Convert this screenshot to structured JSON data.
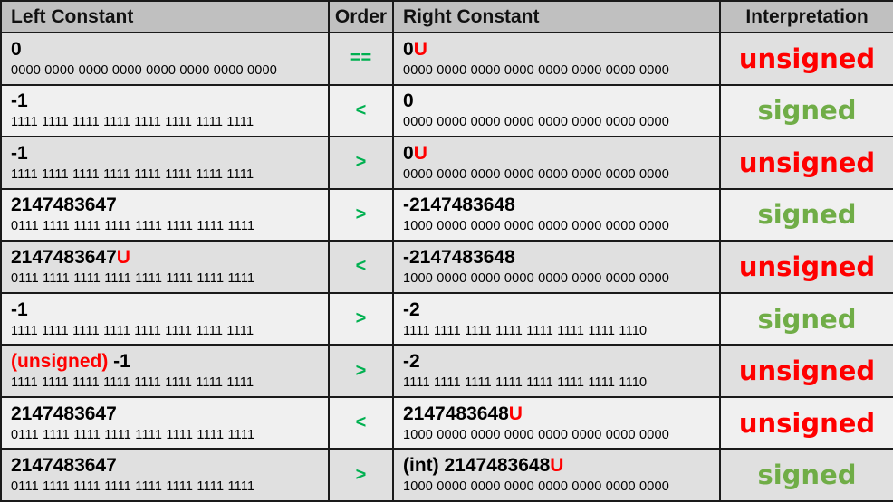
{
  "headers": {
    "left": "Left Constant",
    "order": "Order",
    "right": "Right Constant",
    "interp": "Interpretation"
  },
  "colors": {
    "unsigned": "#ff0000",
    "signed": "#70ad47",
    "order": "#00b050",
    "suffix": "#ff0000"
  },
  "rows": [
    {
      "left": {
        "prefix": "",
        "prefix_red": false,
        "value": "0",
        "suffix": ""
      },
      "left_bits": "0000 0000 0000 0000 0000 0000 0000 0000",
      "order": "==",
      "right": {
        "prefix": "",
        "prefix_red": false,
        "value": "0",
        "suffix": "U"
      },
      "right_bits": "0000 0000 0000 0000 0000 0000 0000 0000",
      "interp": "unsigned"
    },
    {
      "left": {
        "prefix": "",
        "prefix_red": false,
        "value": "-1",
        "suffix": ""
      },
      "left_bits": "1111 1111 1111 1111 1111 1111 1111 1111",
      "order": "<",
      "right": {
        "prefix": "",
        "prefix_red": false,
        "value": "0",
        "suffix": ""
      },
      "right_bits": "0000 0000 0000 0000 0000 0000 0000 0000",
      "interp": "signed"
    },
    {
      "left": {
        "prefix": "",
        "prefix_red": false,
        "value": "-1",
        "suffix": ""
      },
      "left_bits": "1111 1111 1111 1111 1111 1111 1111 1111",
      "order": ">",
      "right": {
        "prefix": "",
        "prefix_red": false,
        "value": "0",
        "suffix": "U"
      },
      "right_bits": "0000 0000 0000 0000 0000 0000 0000 0000",
      "interp": "unsigned"
    },
    {
      "left": {
        "prefix": "",
        "prefix_red": false,
        "value": "2147483647",
        "suffix": ""
      },
      "left_bits": "0111 1111 1111 1111 1111 1111 1111 1111",
      "order": ">",
      "right": {
        "prefix": "",
        "prefix_red": false,
        "value": "-2147483648",
        "suffix": ""
      },
      "right_bits": "1000 0000 0000 0000 0000 0000 0000 0000",
      "interp": "signed"
    },
    {
      "left": {
        "prefix": "",
        "prefix_red": false,
        "value": "2147483647",
        "suffix": "U"
      },
      "left_bits": "0111 1111 1111 1111 1111 1111 1111 1111",
      "order": "<",
      "right": {
        "prefix": "",
        "prefix_red": false,
        "value": "-2147483648",
        "suffix": ""
      },
      "right_bits": "1000 0000 0000 0000 0000 0000 0000 0000",
      "interp": "unsigned"
    },
    {
      "left": {
        "prefix": "",
        "prefix_red": false,
        "value": "-1",
        "suffix": ""
      },
      "left_bits": "1111 1111 1111 1111 1111 1111 1111 1111",
      "order": ">",
      "right": {
        "prefix": "",
        "prefix_red": false,
        "value": "-2",
        "suffix": ""
      },
      "right_bits": "1111 1111 1111 1111 1111 1111 1111 1110",
      "interp": "signed"
    },
    {
      "left": {
        "prefix": "(unsigned) ",
        "prefix_red": true,
        "value": "-1",
        "suffix": ""
      },
      "left_bits": "1111 1111 1111 1111 1111 1111 1111 1111",
      "order": ">",
      "right": {
        "prefix": "",
        "prefix_red": false,
        "value": "-2",
        "suffix": ""
      },
      "right_bits": "1111 1111 1111 1111 1111 1111 1111 1110",
      "interp": "unsigned"
    },
    {
      "left": {
        "prefix": "",
        "prefix_red": false,
        "value": "2147483647",
        "suffix": ""
      },
      "left_bits": "0111 1111 1111 1111 1111 1111 1111 1111",
      "order": "<",
      "right": {
        "prefix": "",
        "prefix_red": false,
        "value": "2147483648",
        "suffix": "U"
      },
      "right_bits": "1000 0000 0000 0000 0000 0000 0000 0000",
      "interp": "unsigned"
    },
    {
      "left": {
        "prefix": "",
        "prefix_red": false,
        "value": "2147483647",
        "suffix": ""
      },
      "left_bits": "0111 1111 1111 1111 1111 1111 1111 1111",
      "order": ">",
      "right": {
        "prefix": "(int) ",
        "prefix_red": false,
        "value": "2147483648",
        "suffix": "U"
      },
      "right_bits": "1000 0000 0000 0000 0000 0000 0000 0000",
      "interp": "signed"
    }
  ]
}
